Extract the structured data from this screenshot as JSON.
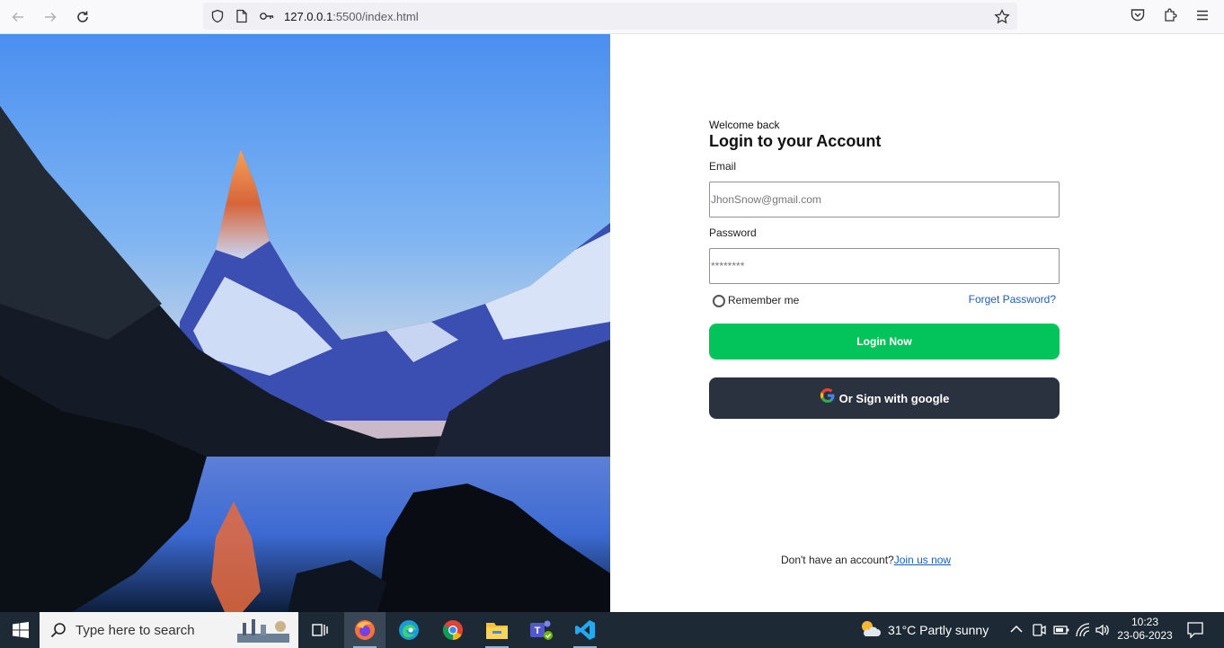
{
  "browser": {
    "url_host": "127.0.0.1",
    "url_rest": ":5500/index.html"
  },
  "login": {
    "welcome": "Welcome back",
    "title": "Login to your Account",
    "email_label": "Email",
    "email_placeholder": "JhonSnow@gmail.com",
    "password_label": "Password",
    "password_placeholder": "********",
    "remember_label": "Remember me",
    "forgot_label": "Forget Password?",
    "login_button": "Login Now",
    "google_button": "Or Sign with google",
    "signup_text": "Don't have an account?",
    "signup_link": "Join us now"
  },
  "taskbar": {
    "search_placeholder": "Type here to search",
    "weather": "31°C  Partly sunny",
    "time": "10:23",
    "date": "23-06-2023"
  },
  "colors": {
    "login_button": "#02c45a",
    "google_button": "#2b323f",
    "link": "#1a5fb4"
  }
}
